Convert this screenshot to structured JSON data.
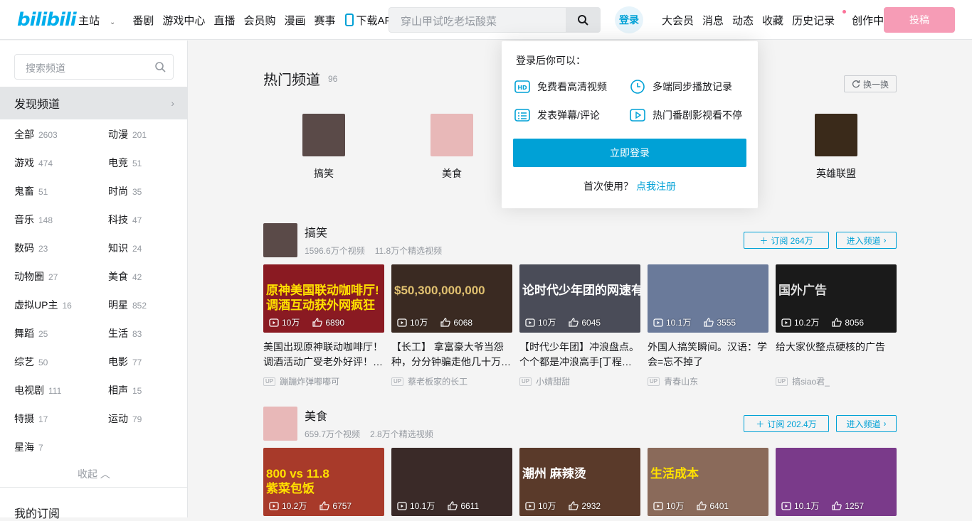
{
  "header": {
    "logo": "bilibili",
    "nav": [
      "主站",
      "番剧",
      "游戏中心",
      "直播",
      "会员购",
      "漫画",
      "赛事",
      "下载APP"
    ],
    "search_placeholder": "穿山甲试吃老坛酸菜",
    "login": "登录",
    "right_nav": [
      "大会员",
      "消息",
      "动态",
      "收藏",
      "历史记录",
      "创作中心"
    ],
    "upload": "投稿"
  },
  "sidebar": {
    "search_placeholder": "搜索频道",
    "discover": "发现频道",
    "categories": [
      {
        "name": "全部",
        "count": "2603"
      },
      {
        "name": "动漫",
        "count": "201"
      },
      {
        "name": "游戏",
        "count": "474"
      },
      {
        "name": "电竞",
        "count": "51"
      },
      {
        "name": "鬼畜",
        "count": "51"
      },
      {
        "name": "时尚",
        "count": "35"
      },
      {
        "name": "音乐",
        "count": "148"
      },
      {
        "name": "科技",
        "count": "47"
      },
      {
        "name": "数码",
        "count": "23"
      },
      {
        "name": "知识",
        "count": "24"
      },
      {
        "name": "动物圈",
        "count": "27"
      },
      {
        "name": "美食",
        "count": "42"
      },
      {
        "name": "虚拟UP主",
        "count": "16"
      },
      {
        "name": "明星",
        "count": "852"
      },
      {
        "name": "舞蹈",
        "count": "25"
      },
      {
        "name": "生活",
        "count": "83"
      },
      {
        "name": "综艺",
        "count": "50"
      },
      {
        "name": "电影",
        "count": "77"
      },
      {
        "name": "电视剧",
        "count": "111"
      },
      {
        "name": "相声",
        "count": "15"
      },
      {
        "name": "特摄",
        "count": "17"
      },
      {
        "name": "运动",
        "count": "79"
      },
      {
        "name": "星海",
        "count": "7"
      }
    ],
    "collapse": "收起",
    "my_subscriptions": "我的订阅"
  },
  "hot": {
    "title": "热门频道",
    "count": "96",
    "swap": "换一换",
    "items": [
      {
        "name": "搞笑",
        "color": "#5a4a48"
      },
      {
        "name": "美食",
        "color": "#e8b8b8"
      },
      {
        "name": "英雄联盟",
        "color": "#3a2a1a"
      }
    ]
  },
  "login_popup": {
    "tip": "登录后你可以：",
    "features": [
      "免费看高清视频",
      "多端同步播放记录",
      "发表弹幕/评论",
      "热门番剧影视看不停"
    ],
    "button": "立即登录",
    "first_use": "首次使用？",
    "register": "点我注册"
  },
  "sections": [
    {
      "name": "搞笑",
      "videos_count": "1596.6万个视频",
      "featured_count": "11.8万个精选视频",
      "subscribe": "订阅 264万",
      "enter": "进入频道",
      "avatar_color": "#5a4a48",
      "videos": [
        {
          "title": "美国出现原神联动咖啡厅！调酒活动广受老外好评！…",
          "up": "蹦蹦炸弹嘟嘟可",
          "views": "10万",
          "likes": "6890",
          "thumb_text": "原神美国联动咖啡厅!\n调酒互动获外网疯狂",
          "bg": "#8a1a22",
          "fg": "#ffe000"
        },
        {
          "title": "【长工】 拿富豪大爷当怨种，分分钟骗走他几十万…",
          "up": "蔡老板家的长工",
          "views": "10万",
          "likes": "6068",
          "thumb_text": "$50,300,000,000",
          "bg": "#3a2a22",
          "fg": "#e0c070"
        },
        {
          "title": "【时代少年团】冲浪盘点。个个都是冲浪高手[丁程…",
          "up": "小婧甜甜",
          "views": "10万",
          "likes": "6045",
          "thumb_text": "论时代少年团的网速有多快",
          "bg": "#4a4c58",
          "fg": "#ffffff"
        },
        {
          "title": "外国人搞笑瞬间。汉语：学会=忘不掉了",
          "up": "青春山东",
          "views": "10.1万",
          "likes": "3555",
          "thumb_text": "",
          "bg": "#6a7a9a",
          "fg": "#ffffff"
        },
        {
          "title": "给大家伙整点硬核的广告",
          "up": "搞siao君_",
          "views": "10.2万",
          "likes": "8056",
          "thumb_text": "国外广告",
          "bg": "#1a1a1a",
          "fg": "#dddddd"
        }
      ]
    },
    {
      "name": "美食",
      "videos_count": "659.7万个视频",
      "featured_count": "2.8万个精选视频",
      "subscribe": "订阅 202.4万",
      "enter": "进入频道",
      "avatar_color": "#e8b8b8",
      "videos": [
        {
          "title": "",
          "up": "",
          "views": "10.2万",
          "likes": "6757",
          "thumb_text": "800 vs 11.8\n紫菜包饭",
          "bg": "#a83a2a",
          "fg": "#ffe000"
        },
        {
          "title": "",
          "up": "",
          "views": "10.1万",
          "likes": "6611",
          "thumb_text": "",
          "bg": "#3a2a28",
          "fg": "#ffd000"
        },
        {
          "title": "",
          "up": "",
          "views": "10万",
          "likes": "2932",
          "thumb_text": "潮州  麻辣烫",
          "bg": "#5a3a2a",
          "fg": "#ffffff"
        },
        {
          "title": "",
          "up": "",
          "views": "10万",
          "likes": "6401",
          "thumb_text": "生活成本",
          "bg": "#8a6a5a",
          "fg": "#ffe000"
        },
        {
          "title": "",
          "up": "",
          "views": "10.1万",
          "likes": "1257",
          "thumb_text": "",
          "bg": "#7a3a8a",
          "fg": "#ffffff"
        }
      ]
    }
  ]
}
